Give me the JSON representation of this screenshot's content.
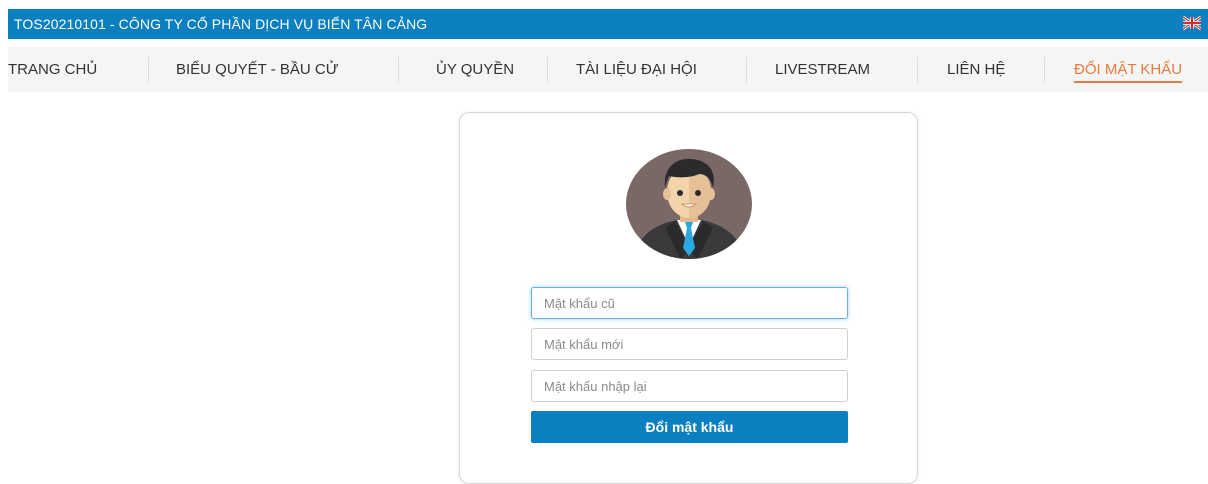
{
  "header": {
    "title": "TOS20210101 - CÔNG TY CỔ PHẦN DỊCH VỤ BIỂN TÂN CẢNG",
    "language_icon": "uk-flag-icon",
    "accent_color": "#0b7fc0"
  },
  "nav": {
    "items": [
      {
        "label": "TRANG CHỦ",
        "icon": ""
      },
      {
        "label": "BIỂU QUYẾT - BẦU CỬ",
        "icon": ""
      },
      {
        "label": "ỦY QUYỀN",
        "icon": ""
      },
      {
        "label": "TÀI LIỆU ĐẠI HỘI",
        "icon": ""
      },
      {
        "label": "LIVESTREAM",
        "icon": ""
      },
      {
        "label": "LIÊN HỆ",
        "icon": ""
      },
      {
        "label": "ĐỔI MẬT KHẨU",
        "icon": "",
        "active": true
      }
    ],
    "active_color": "#e87a3c"
  },
  "form": {
    "avatar_icon": "businessman-avatar-icon",
    "old_password": {
      "placeholder": "Mật khẩu cũ",
      "value": ""
    },
    "new_password": {
      "placeholder": "Mật khẩu mới",
      "value": ""
    },
    "confirm_password": {
      "placeholder": "Mật khẩu nhập lại",
      "value": ""
    },
    "submit_label": "Đổi mật khẩu"
  }
}
